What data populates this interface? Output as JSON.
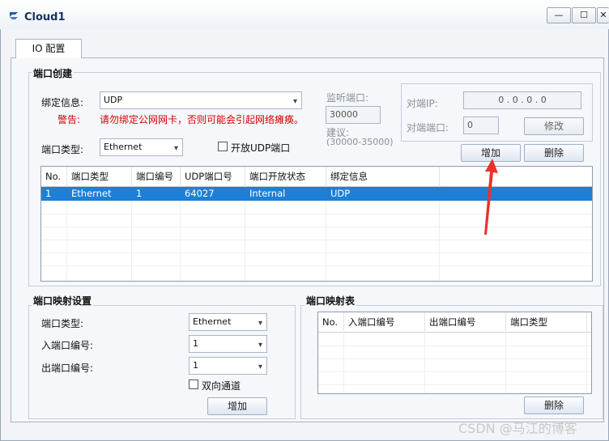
{
  "window": {
    "title": "Cloud1",
    "minimize_glyph": "—",
    "maximize_glyph": "☐",
    "close_glyph": "✕"
  },
  "tabs": [
    {
      "label": "IO 配置",
      "selected": true
    }
  ],
  "port_create": {
    "title": "端口创建",
    "bind_label": "绑定信息:",
    "bind_value": "UDP",
    "warning_label": "警告:",
    "warning_text": "请勿绑定公网网卡，否则可能会引起网络瘫痪。",
    "port_type_label": "端口类型:",
    "port_type_value": "Ethernet",
    "open_udp_label": "开放UDP端口",
    "listen_port_label": "监听端口:",
    "listen_port_value": "30000",
    "suggest_label": "建议:",
    "suggest_range": "(30000-35000)",
    "peer_ip_label": "对端IP:",
    "peer_ip_value": "0 . 0 . 0 . 0",
    "peer_port_label": "对端端口:",
    "peer_port_value": "0",
    "modify_button": "修改",
    "add_button": "增加",
    "delete_button": "删除",
    "table": {
      "columns": [
        "No.",
        "端口类型",
        "端口编号",
        "UDP端口号",
        "端口开放状态",
        "绑定信息"
      ],
      "rows": [
        [
          "1",
          "Ethernet",
          "1",
          "64027",
          "Internal",
          "UDP"
        ]
      ]
    }
  },
  "port_mapping_settings": {
    "title": "端口映射设置",
    "port_type_label": "端口类型:",
    "port_type_value": "Ethernet",
    "in_port_label": "入端口编号:",
    "in_port_value": "1",
    "out_port_label": "出端口编号:",
    "out_port_value": "1",
    "bidirectional_label": "双向通道",
    "add_button": "增加"
  },
  "port_mapping_table": {
    "title": "端口映射表",
    "columns": [
      "No.",
      "入端口编号",
      "出端口编号",
      "端口类型"
    ],
    "delete_button": "删除"
  },
  "watermark": "CSDN @马江的博客",
  "colors": {
    "selection": "#1e7fd6",
    "warning_red": "#d40000",
    "annotation_arrow": "#e8322b"
  }
}
